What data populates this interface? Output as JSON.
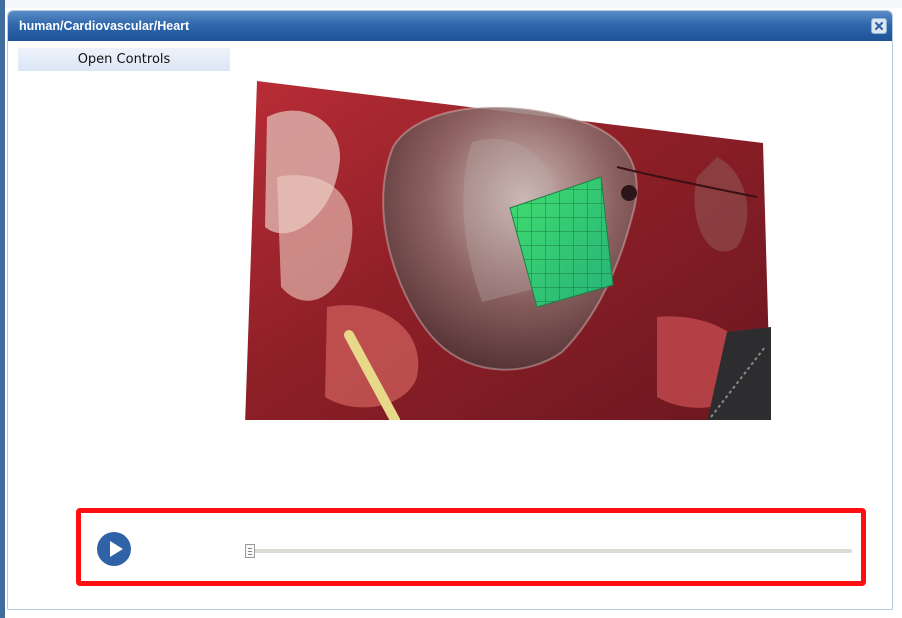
{
  "window": {
    "title": "human/Cardiovascular/Heart",
    "close_icon": "close-icon"
  },
  "controls": {
    "open_controls_label": "Open Controls"
  },
  "viewer": {
    "content": "surgical-video-frame-with-3d-heart-overlay",
    "overlay_color": "#33d17a"
  },
  "player": {
    "play_icon": "play-icon",
    "progress": 0,
    "highlight_color": "#ff1010",
    "accent_color": "#2f62a6"
  }
}
